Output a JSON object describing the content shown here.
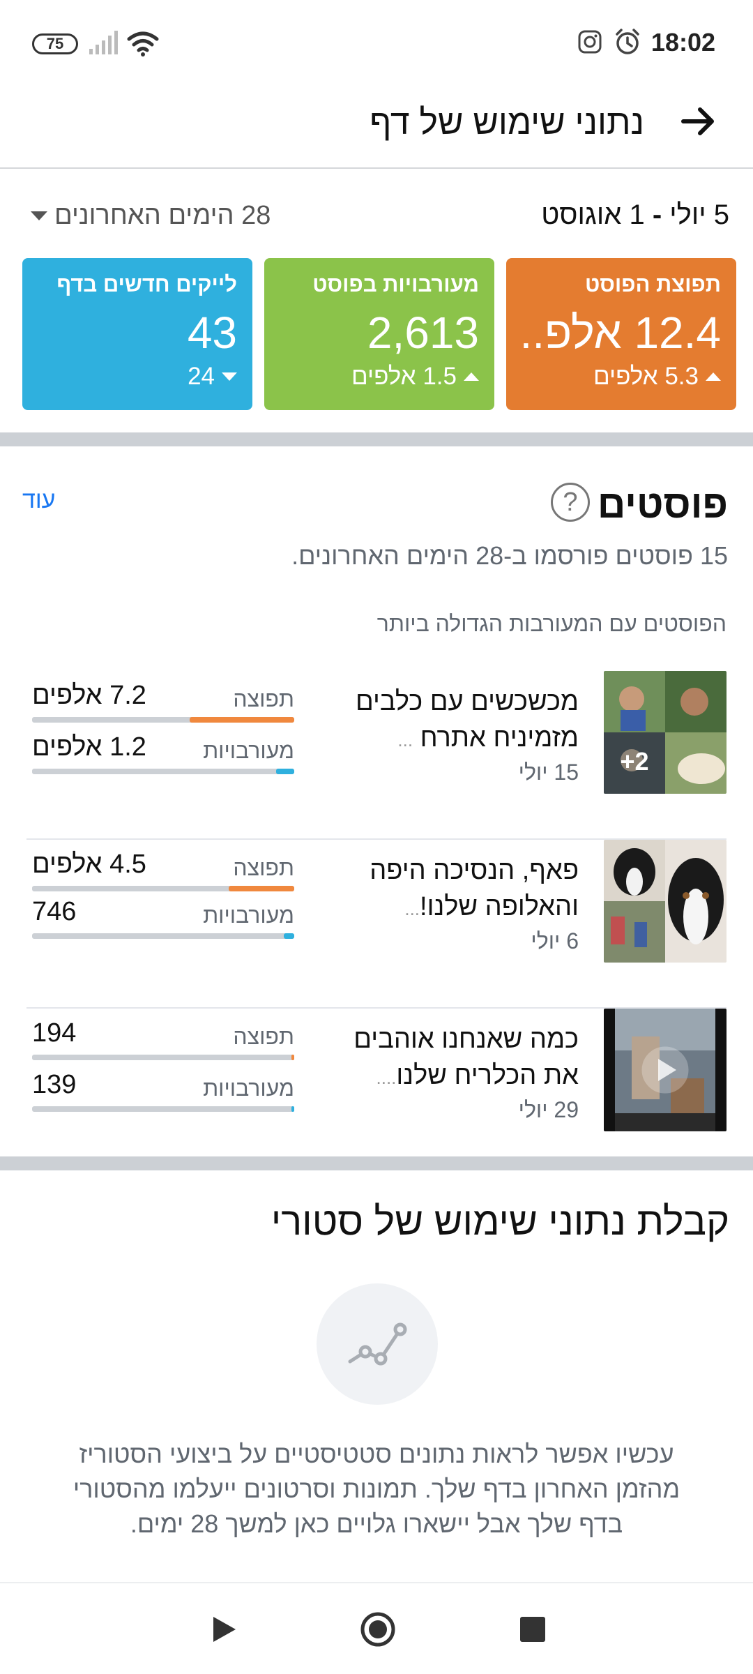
{
  "status_bar": {
    "time": "18:02",
    "battery": "75",
    "icons": [
      "alarm-icon",
      "instagram-icon",
      "signal-icon",
      "wifi-icon"
    ]
  },
  "header": {
    "title": "נתוני שימוש של דף",
    "back_icon": "arrow-right-icon"
  },
  "overview": {
    "date_start": "5 יולי",
    "date_sep": " - ",
    "date_end": "1 אוגוסט",
    "period": "28 הימים האחרונים",
    "cards": [
      {
        "title": "תפוצת הפוסט",
        "value": "12.4 אלפ..",
        "change": "5.3 אלפים",
        "direction": "up",
        "color": "#e47c30"
      },
      {
        "title": "מעורבויות בפוסט",
        "value": "2,613",
        "change": "1.5 אלפים",
        "direction": "up",
        "color": "#8bc34a"
      },
      {
        "title": "לייקים חדשים בדף",
        "value": "43",
        "change": "24",
        "direction": "down",
        "color": "#2fb0de"
      }
    ]
  },
  "posts": {
    "title": "פוסטים",
    "more": "עוד",
    "subtitle": "15 פוסטים פורסמו ב-28 הימים האחרונים.",
    "top_label": "הפוסטים עם המעורבות הגדולה ביותר",
    "reach_label": "תפוצה",
    "engagement_label": "מעורבויות",
    "items": [
      {
        "title_line1": "מכשכשים עם כלבים",
        "title_line2": "מזמיניח אתרח",
        "ellipsis": "...",
        "date": "15 יולי",
        "thumb_badge": "+2",
        "reach": "7.2 אלפים",
        "reach_fraction": 0.4,
        "engagement": "1.2 אלפים",
        "engagement_fraction": 0.07
      },
      {
        "title_line1": "פאף, הנסיכה היפה",
        "title_line2": "והאלופה שלנו!",
        "ellipsis": "...",
        "date": "6 יולי",
        "thumb_badge": "",
        "reach": "4.5 אלפים",
        "reach_fraction": 0.25,
        "engagement": "746",
        "engagement_fraction": 0.04
      },
      {
        "title_line1": "כמה שאנחנו אוהבים",
        "title_line2": "את הכלריח שלנו",
        "ellipsis": "....",
        "date": "29 יולי",
        "thumb_badge": "",
        "reach": "194",
        "reach_fraction": 0.01,
        "engagement": "139",
        "engagement_fraction": 0.01
      }
    ]
  },
  "stories": {
    "title": "קבלת נתוני שימוש של סטורי",
    "icon": "trend-line-icon",
    "body": "עכשיו אפשר לראות נתונים סטטיסטיים על ביצועי הסטוריז מהזמן האחרון בדף שלך. תמונות וסרטונים ייעלמו מהסטורי בדף שלך אבל יישארו גלויים כאן למשך 28 ימים."
  },
  "nav": {
    "icons": [
      "back-triangle-icon",
      "home-circle-icon",
      "recents-square-icon"
    ]
  },
  "colors": {
    "reach_bar": "#f0883e",
    "engagement_bar": "#2fb0de",
    "link": "#1877f2"
  }
}
